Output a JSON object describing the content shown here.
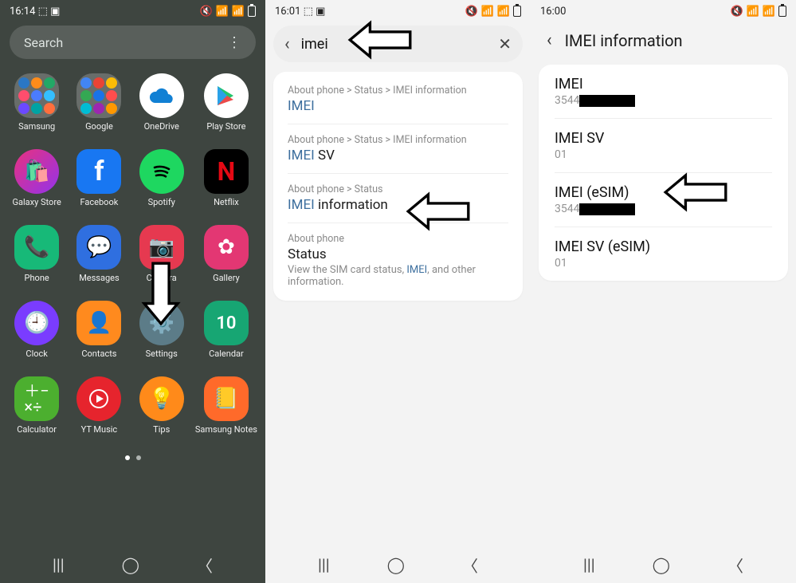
{
  "screen1": {
    "time": "16:14",
    "search_placeholder": "Search",
    "apps": [
      {
        "label": "Samsung"
      },
      {
        "label": "Google"
      },
      {
        "label": "OneDrive"
      },
      {
        "label": "Play Store"
      },
      {
        "label": "Galaxy Store"
      },
      {
        "label": "Facebook"
      },
      {
        "label": "Spotify"
      },
      {
        "label": "Netflix"
      },
      {
        "label": "Phone"
      },
      {
        "label": "Messages"
      },
      {
        "label": "Camera"
      },
      {
        "label": "Gallery"
      },
      {
        "label": "Clock"
      },
      {
        "label": "Contacts"
      },
      {
        "label": "Settings"
      },
      {
        "label": "Calendar"
      },
      {
        "label": "Calculator"
      },
      {
        "label": "YT Music"
      },
      {
        "label": "Tips"
      },
      {
        "label": "Samsung Notes"
      }
    ]
  },
  "screen2": {
    "time": "16:01",
    "query": "imei",
    "results": [
      {
        "breadcrumb": "About phone > Status > IMEI information",
        "title_hl": "IMEI",
        "title_rest": ""
      },
      {
        "breadcrumb": "About phone > Status > IMEI information",
        "title_hl": "IMEI",
        "title_rest": " SV"
      },
      {
        "breadcrumb": "About phone > Status",
        "title_hl": "IMEI",
        "title_rest": " information"
      },
      {
        "breadcrumb": "About phone",
        "title_hl": "",
        "title_rest": "Status",
        "sub_pre": "View the SIM card status, ",
        "sub_hl": "IMEI",
        "sub_post": ", and other information."
      }
    ]
  },
  "screen3": {
    "time": "16:00",
    "page_title": "IMEI information",
    "items": [
      {
        "label": "IMEI",
        "value_prefix": "3544",
        "redacted": true
      },
      {
        "label": "IMEI SV",
        "value_prefix": "01",
        "redacted": false
      },
      {
        "label": "IMEI (eSIM)",
        "value_prefix": "3544",
        "redacted": true
      },
      {
        "label": "IMEI SV (eSIM)",
        "value_prefix": "01",
        "redacted": false
      }
    ]
  },
  "calendar_day": "10"
}
